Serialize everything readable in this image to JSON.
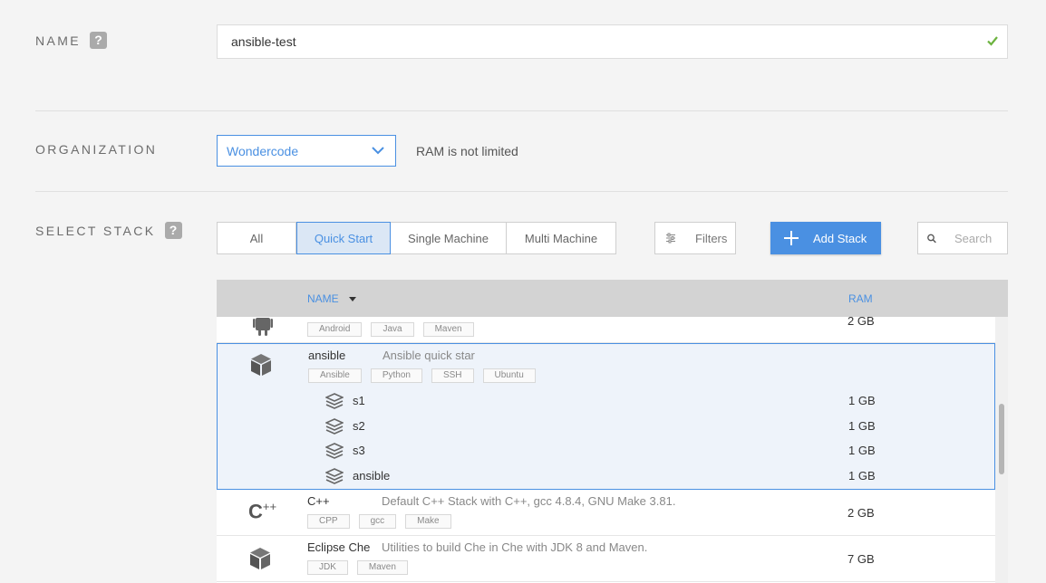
{
  "name_section": {
    "label": "NAME",
    "help": "?",
    "value": "ansible-test"
  },
  "org_section": {
    "label": "ORGANIZATION",
    "selected": "Wondercode",
    "ram_note": "RAM is not limited"
  },
  "stack_section": {
    "label": "SELECT STACK",
    "help": "?",
    "tabs": [
      "All",
      "Quick Start",
      "Single Machine",
      "Multi Machine"
    ],
    "active_tab": "Quick Start",
    "filters_label": "Filters",
    "add_stack_label": "Add Stack",
    "search_placeholder": "Search"
  },
  "table": {
    "columns": {
      "name": "NAME",
      "ram": "RAM"
    },
    "rows": [
      {
        "name": "",
        "description": "",
        "tags": [
          "Android",
          "Java",
          "Maven"
        ],
        "ram": "2 GB",
        "icon": "android-icon"
      },
      {
        "name": "ansible",
        "description": "Ansible quick star",
        "tags": [
          "Ansible",
          "Python",
          "SSH",
          "Ubuntu"
        ],
        "ram": "",
        "icon": "cube-icon",
        "machines": [
          {
            "name": "s1",
            "ram": "1 GB"
          },
          {
            "name": "s2",
            "ram": "1 GB"
          },
          {
            "name": "s3",
            "ram": "1 GB"
          },
          {
            "name": "ansible",
            "ram": "1 GB"
          }
        ]
      },
      {
        "name": "C++",
        "description": "Default C++ Stack with C++, gcc 4.8.4, GNU Make 3.81.",
        "tags": [
          "CPP",
          "gcc",
          "Make"
        ],
        "ram": "2 GB",
        "icon": "cpp-icon",
        "icon_text": "C++"
      },
      {
        "name": "Eclipse Che",
        "description": "Utilities to build Che in Che with JDK 8 and Maven.",
        "tags": [
          "JDK",
          "Maven"
        ],
        "ram": "7 GB",
        "icon": "cube-icon"
      }
    ]
  },
  "colors": {
    "accent": "#4a90e2",
    "valid": "#6cb33f"
  }
}
